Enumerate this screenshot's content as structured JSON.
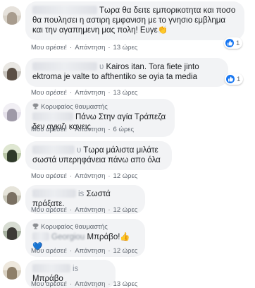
{
  "actions": {
    "like": "Μου αρέσει!",
    "reply": "Απάντηση",
    "dot": "·"
  },
  "badge_label": "Κορυφαίος θαυμαστής",
  "comments": [
    {
      "name_tail": "",
      "text": "Τωρα θα δειτε εμπορικοτητα και ποσο θα πουλησει η αστιρη εμφανιση με το γνησιο εμβλημα και την αγαπημενη μας πολη! Ευγε👏",
      "time": "13 ώρες",
      "reactions": "1"
    },
    {
      "name_tail": "υ",
      "text": "Kairos itan. Tora fiete jinto ektroma je valte to afthentiko se oyia ta media",
      "time": "13 ώρες",
      "reactions": "1"
    },
    {
      "name_tail": "",
      "text": "Πάνω Στην αγία Τράπεζα δεν αγκιζι κανεις",
      "time": "6 ώρες"
    },
    {
      "name_tail": "υ",
      "text": "Τωρα μάλιστα μιλάτε σωστά υπερηφάνεια πάνω απο όλα",
      "time": "12 ώρες"
    },
    {
      "name_tail": "is",
      "text": "Σωστά πράξατε.",
      "time": "12 ώρες"
    },
    {
      "name_tail": "Georgiou",
      "text": "Μπράβο!👍💙",
      "time": "12 ώρες"
    },
    {
      "name_tail": "is",
      "text": "Μπράβο",
      "time": "13 ώρες"
    }
  ],
  "colors": {
    "bubble": "#f2f3f5",
    "meta_text": "#606770",
    "like_blue": "#1877f2",
    "trophy": "#8a8d91"
  }
}
